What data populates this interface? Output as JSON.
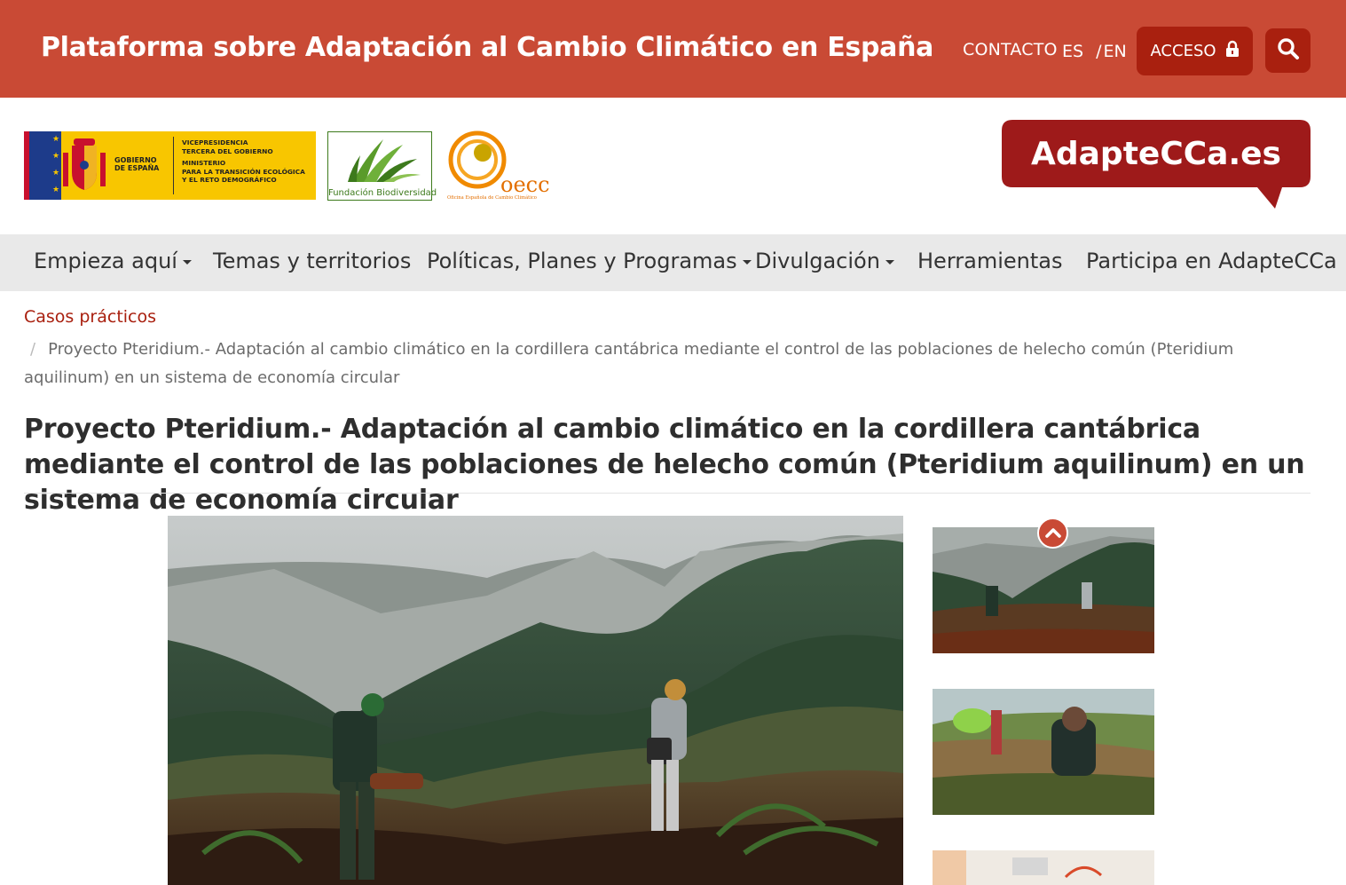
{
  "header": {
    "site_title": "Plataforma sobre Adaptación al Cambio Climático en España",
    "contact": "CONTACTO",
    "lang_es": "ES",
    "lang_sep": "/",
    "lang_en": "EN",
    "access_label": "ACCESO",
    "colors": {
      "bar": "#c94a35",
      "button": "#a9200f"
    }
  },
  "logos": {
    "gov_main": "GOBIERNO\nDE ESPAÑA",
    "gov_ministry_lines": [
      "VICEPRESIDENCIA",
      "TERCERA DEL GOBIERNO",
      "",
      "MINISTERIO",
      "PARA LA TRANSICIÓN ECOLÓGICA",
      "Y EL RETO DEMOGRÁFICO"
    ],
    "fb_name": "Fundación Biodiversidad",
    "oecc_name": "oecc",
    "oecc_sub": "Oficina Española de Cambio Climático",
    "adapte_name": "AdapteCCa.es"
  },
  "nav": {
    "items": [
      {
        "label": "Empieza aquí",
        "dropdown": true
      },
      {
        "label": "Temas y territorios",
        "dropdown": false
      },
      {
        "label": "Políticas, Planes y Programas",
        "dropdown": true
      },
      {
        "label": "Divulgación",
        "dropdown": true
      },
      {
        "label": "Herramientas",
        "dropdown": false
      },
      {
        "label": "Participa en AdapteCCa",
        "dropdown": false
      }
    ]
  },
  "breadcrumb": {
    "parent": "Casos prácticos",
    "separator": "/",
    "current": "Proyecto Pteridium.- Adaptación al cambio climático en la cordillera cantábrica mediante el control de las poblaciones de helecho común (Pteridium aquilinum) en un sistema de economía circular"
  },
  "page": {
    "title": "Proyecto Pteridium.- Adaptación al cambio climático en la cordillera cantábrica mediante el control de las poblaciones de helecho común (Pteridium aquilinum) en un sistema de economía circular"
  },
  "gallery": {
    "icons": [
      "chevron-up-icon",
      "lock-icon",
      "search-icon"
    ]
  }
}
